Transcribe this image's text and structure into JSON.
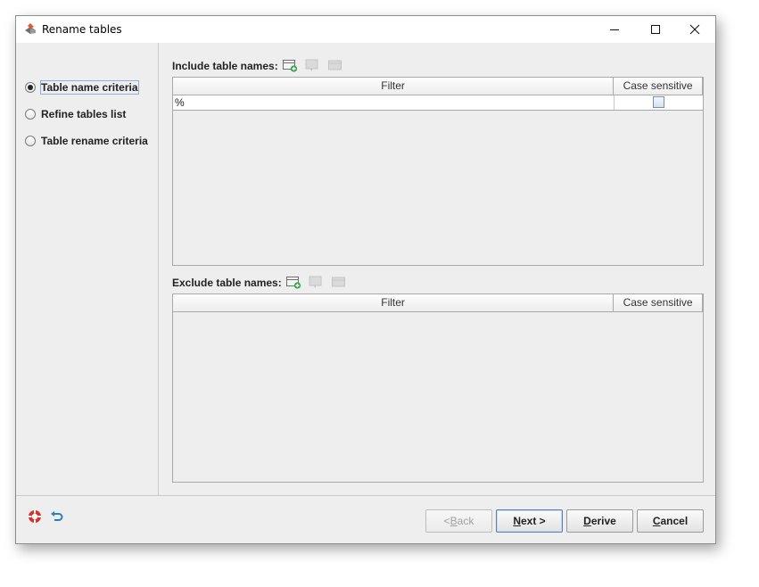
{
  "window": {
    "title": "Rename tables"
  },
  "nav": {
    "items": [
      {
        "label": "Table name criteria",
        "selected": true
      },
      {
        "label": "Refine tables list",
        "selected": false
      },
      {
        "label": "Table rename criteria",
        "selected": false
      }
    ]
  },
  "include": {
    "label": "Include table names:",
    "columns": [
      "Filter",
      "Case sensitive"
    ],
    "rows": [
      {
        "filter": "%",
        "case_sensitive": false
      }
    ]
  },
  "exclude": {
    "label": "Exclude table names:",
    "columns": [
      "Filter",
      "Case sensitive"
    ],
    "rows": []
  },
  "buttons": {
    "back": {
      "pre": "< ",
      "mnemonic": "B",
      "post": "ack"
    },
    "next": {
      "pre": "",
      "mnemonic": "N",
      "post": "ext >"
    },
    "derive": {
      "pre": "",
      "mnemonic": "D",
      "post": "erive"
    },
    "cancel": {
      "pre": "",
      "mnemonic": "C",
      "post": "ancel"
    }
  },
  "icons": {
    "app": "app-icon",
    "add": "add-row-icon",
    "edit": "edit-row-icon",
    "remove": "remove-row-icon",
    "help": "help-icon",
    "undo": "undo-icon"
  },
  "colors": {
    "accent": "#5a7fb0",
    "panel": "#eeeeee",
    "help_red": "#d9312b",
    "undo_blue": "#2a7fc1"
  }
}
